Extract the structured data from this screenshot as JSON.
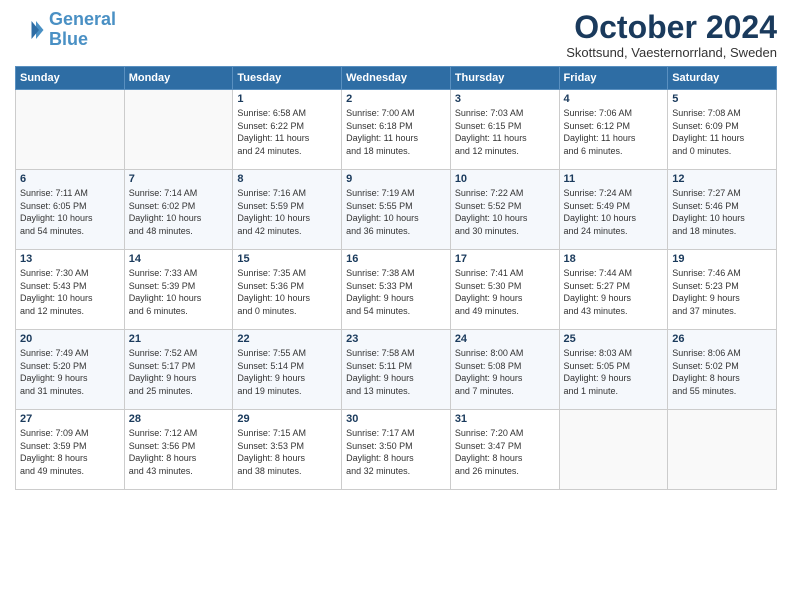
{
  "header": {
    "logo_line1": "General",
    "logo_line2": "Blue",
    "title": "October 2024",
    "location": "Skottsund, Vaesternorrland, Sweden"
  },
  "weekdays": [
    "Sunday",
    "Monday",
    "Tuesday",
    "Wednesday",
    "Thursday",
    "Friday",
    "Saturday"
  ],
  "weeks": [
    [
      {
        "day": "",
        "info": ""
      },
      {
        "day": "",
        "info": ""
      },
      {
        "day": "1",
        "info": "Sunrise: 6:58 AM\nSunset: 6:22 PM\nDaylight: 11 hours\nand 24 minutes."
      },
      {
        "day": "2",
        "info": "Sunrise: 7:00 AM\nSunset: 6:18 PM\nDaylight: 11 hours\nand 18 minutes."
      },
      {
        "day": "3",
        "info": "Sunrise: 7:03 AM\nSunset: 6:15 PM\nDaylight: 11 hours\nand 12 minutes."
      },
      {
        "day": "4",
        "info": "Sunrise: 7:06 AM\nSunset: 6:12 PM\nDaylight: 11 hours\nand 6 minutes."
      },
      {
        "day": "5",
        "info": "Sunrise: 7:08 AM\nSunset: 6:09 PM\nDaylight: 11 hours\nand 0 minutes."
      }
    ],
    [
      {
        "day": "6",
        "info": "Sunrise: 7:11 AM\nSunset: 6:05 PM\nDaylight: 10 hours\nand 54 minutes."
      },
      {
        "day": "7",
        "info": "Sunrise: 7:14 AM\nSunset: 6:02 PM\nDaylight: 10 hours\nand 48 minutes."
      },
      {
        "day": "8",
        "info": "Sunrise: 7:16 AM\nSunset: 5:59 PM\nDaylight: 10 hours\nand 42 minutes."
      },
      {
        "day": "9",
        "info": "Sunrise: 7:19 AM\nSunset: 5:55 PM\nDaylight: 10 hours\nand 36 minutes."
      },
      {
        "day": "10",
        "info": "Sunrise: 7:22 AM\nSunset: 5:52 PM\nDaylight: 10 hours\nand 30 minutes."
      },
      {
        "day": "11",
        "info": "Sunrise: 7:24 AM\nSunset: 5:49 PM\nDaylight: 10 hours\nand 24 minutes."
      },
      {
        "day": "12",
        "info": "Sunrise: 7:27 AM\nSunset: 5:46 PM\nDaylight: 10 hours\nand 18 minutes."
      }
    ],
    [
      {
        "day": "13",
        "info": "Sunrise: 7:30 AM\nSunset: 5:43 PM\nDaylight: 10 hours\nand 12 minutes."
      },
      {
        "day": "14",
        "info": "Sunrise: 7:33 AM\nSunset: 5:39 PM\nDaylight: 10 hours\nand 6 minutes."
      },
      {
        "day": "15",
        "info": "Sunrise: 7:35 AM\nSunset: 5:36 PM\nDaylight: 10 hours\nand 0 minutes."
      },
      {
        "day": "16",
        "info": "Sunrise: 7:38 AM\nSunset: 5:33 PM\nDaylight: 9 hours\nand 54 minutes."
      },
      {
        "day": "17",
        "info": "Sunrise: 7:41 AM\nSunset: 5:30 PM\nDaylight: 9 hours\nand 49 minutes."
      },
      {
        "day": "18",
        "info": "Sunrise: 7:44 AM\nSunset: 5:27 PM\nDaylight: 9 hours\nand 43 minutes."
      },
      {
        "day": "19",
        "info": "Sunrise: 7:46 AM\nSunset: 5:23 PM\nDaylight: 9 hours\nand 37 minutes."
      }
    ],
    [
      {
        "day": "20",
        "info": "Sunrise: 7:49 AM\nSunset: 5:20 PM\nDaylight: 9 hours\nand 31 minutes."
      },
      {
        "day": "21",
        "info": "Sunrise: 7:52 AM\nSunset: 5:17 PM\nDaylight: 9 hours\nand 25 minutes."
      },
      {
        "day": "22",
        "info": "Sunrise: 7:55 AM\nSunset: 5:14 PM\nDaylight: 9 hours\nand 19 minutes."
      },
      {
        "day": "23",
        "info": "Sunrise: 7:58 AM\nSunset: 5:11 PM\nDaylight: 9 hours\nand 13 minutes."
      },
      {
        "day": "24",
        "info": "Sunrise: 8:00 AM\nSunset: 5:08 PM\nDaylight: 9 hours\nand 7 minutes."
      },
      {
        "day": "25",
        "info": "Sunrise: 8:03 AM\nSunset: 5:05 PM\nDaylight: 9 hours\nand 1 minute."
      },
      {
        "day": "26",
        "info": "Sunrise: 8:06 AM\nSunset: 5:02 PM\nDaylight: 8 hours\nand 55 minutes."
      }
    ],
    [
      {
        "day": "27",
        "info": "Sunrise: 7:09 AM\nSunset: 3:59 PM\nDaylight: 8 hours\nand 49 minutes."
      },
      {
        "day": "28",
        "info": "Sunrise: 7:12 AM\nSunset: 3:56 PM\nDaylight: 8 hours\nand 43 minutes."
      },
      {
        "day": "29",
        "info": "Sunrise: 7:15 AM\nSunset: 3:53 PM\nDaylight: 8 hours\nand 38 minutes."
      },
      {
        "day": "30",
        "info": "Sunrise: 7:17 AM\nSunset: 3:50 PM\nDaylight: 8 hours\nand 32 minutes."
      },
      {
        "day": "31",
        "info": "Sunrise: 7:20 AM\nSunset: 3:47 PM\nDaylight: 8 hours\nand 26 minutes."
      },
      {
        "day": "",
        "info": ""
      },
      {
        "day": "",
        "info": ""
      }
    ]
  ]
}
